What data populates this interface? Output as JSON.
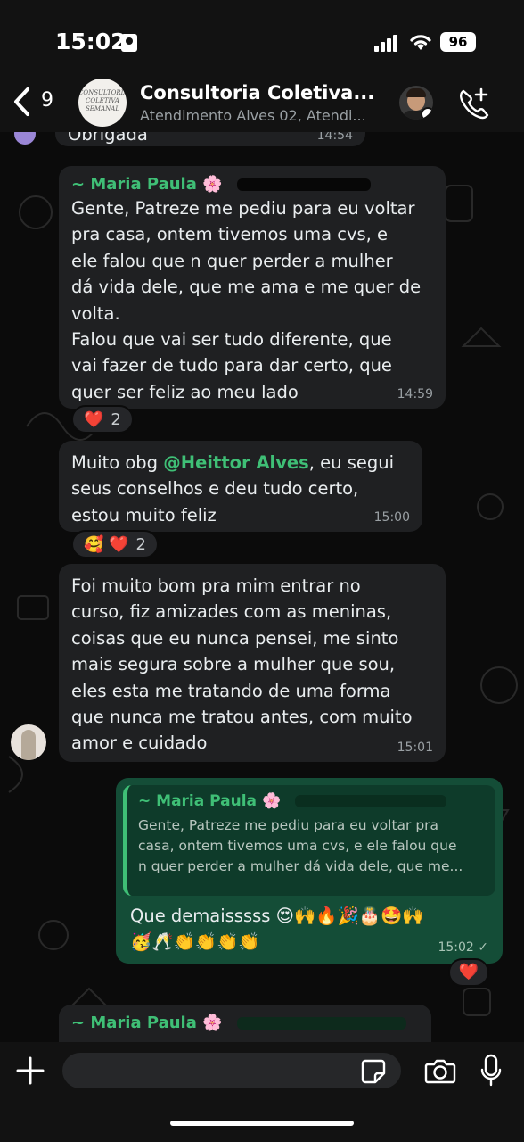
{
  "status_bar": {
    "time": "15:02",
    "battery": "96"
  },
  "header": {
    "back_count": "9",
    "avatar_logo_text": "CONSULTORIA COLETIVA SEMANAL",
    "title": "Consultoria Coletiva...",
    "subtitle": "Atendimento Alves 02, Atendi...",
    "icons": {
      "back": "chevron-left-icon",
      "call": "add-call-icon"
    }
  },
  "messages": [
    {
      "id": "m0",
      "text": "Obrigada",
      "time": "14:54"
    },
    {
      "id": "m1",
      "sender": "~ Maria Paula 🌸",
      "text": "Gente, Patreze me pediu para eu voltar\npra casa, ontem tivemos uma cvs, e\nele falou que n quer perder a mulher\ndá vida dele, que me ama e me quer de\nvolta.\nFalou que vai ser tudo diferente, que\nvai fazer de tudo para dar certo, que\nquer ser feliz ao meu lado",
      "time": "14:59",
      "reactions": "❤️",
      "reaction_count": "2"
    },
    {
      "id": "m2",
      "text_before": "Muito obg ",
      "mention": "@Heittor Alves",
      "text_after": ", eu segui\nseus conselhos e deu tudo certo,\nestou muito feliz",
      "time": "15:00",
      "reactions": "🥰 ❤️",
      "reaction_count": "2"
    },
    {
      "id": "m3",
      "text": "Foi muito bom pra mim entrar no\ncurso, fiz amizades com as meninas,\ncoisas que eu nunca pensei, me sinto\nmais segura sobre a mulher que sou,\neles esta me tratando de uma forma\nque nunca me tratou antes, com muito\namor e cuidado",
      "time": "15:01"
    }
  ],
  "outgoing": {
    "quote_sender": "~ Maria Paula 🌸",
    "quote_text": "Gente, Patreze me pediu para eu voltar pra\ncasa, ontem tivemos uma cvs, e ele falou que\nn quer perder a mulher dá vida dele, que me...",
    "text": "Que demaisssss 😍🙌🔥🎉🎂🤩🙌\n🥳🥂👏👏👏👏",
    "time": "15:02 ✓",
    "reaction": "❤️"
  },
  "partial_message": {
    "sender": "~ Maria Paula 🌸"
  },
  "composer": {
    "icons": [
      "plus-icon",
      "sticker-icon",
      "camera-icon",
      "microphone-icon"
    ]
  },
  "colors": {
    "accent_green": "#3fbf76",
    "outgoing_bubble": "#144d37",
    "incoming_bubble": "#1f2022",
    "background": "#0b0b0b"
  }
}
